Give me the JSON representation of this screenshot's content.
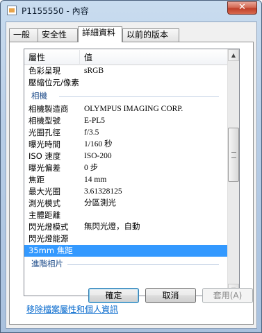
{
  "window": {
    "title": "P1155550 - 內容",
    "close_label": "✕"
  },
  "tabs": [
    {
      "label": "一般",
      "active": false
    },
    {
      "label": "安全性",
      "active": false
    },
    {
      "label": "詳細資料",
      "active": true
    },
    {
      "label": "以前的版本",
      "active": false
    }
  ],
  "list": {
    "header": {
      "property": "屬性",
      "value": "值"
    },
    "rows": [
      {
        "name": "色彩呈現",
        "value": "sRGB"
      },
      {
        "name": "壓縮位元/像素",
        "value": ""
      },
      {
        "name": "相機",
        "value": "",
        "group": true
      },
      {
        "name": "相機製造商",
        "value": "OLYMPUS IMAGING CORP."
      },
      {
        "name": "相機型號",
        "value": "E-PL5"
      },
      {
        "name": "光圈孔徑",
        "value": "f/3.5"
      },
      {
        "name": "曝光時間",
        "value": "1/160 秒"
      },
      {
        "name": "ISO 速度",
        "value": "ISO-200"
      },
      {
        "name": "曝光偏差",
        "value": "0 步"
      },
      {
        "name": "焦距",
        "value": "14 mm"
      },
      {
        "name": "最大光圈",
        "value": "3.61328125"
      },
      {
        "name": "測光模式",
        "value": "分區測光"
      },
      {
        "name": "主體距離",
        "value": ""
      },
      {
        "name": "閃光燈模式",
        "value": "無閃光燈，自動"
      },
      {
        "name": "閃光燈能源",
        "value": ""
      },
      {
        "name": "35mm 焦距",
        "value": "",
        "selected": true
      },
      {
        "name": "進階相片",
        "value": "",
        "group": true
      }
    ]
  },
  "remove_link": "移除檔案屬性和個人資訊",
  "buttons": {
    "ok": "確定",
    "cancel": "取消",
    "apply": "套用(A)"
  },
  "scrollbar": {
    "up_arrow": "▲",
    "down_arrow": "▼"
  }
}
